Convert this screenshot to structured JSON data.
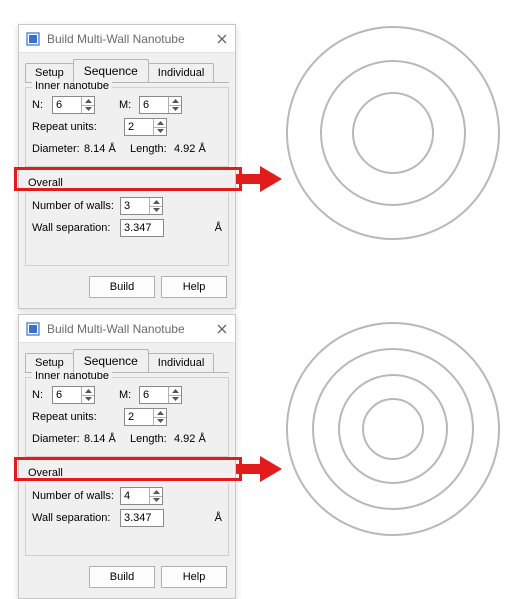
{
  "dialogs": {
    "top": {
      "title": "Build Multi-Wall Nanotube",
      "close_icon": "close",
      "tab_setup": "Setup",
      "tab_sequence": "Sequence",
      "tab_individual": "Individual",
      "inner_group": "Inner nanotube",
      "n_label": "N:",
      "n_value": "6",
      "m_label": "M:",
      "m_value": "6",
      "repeat_label": "Repeat units:",
      "repeat_value": "2",
      "diameter_label": "Diameter:",
      "diameter_value": "8.14 Å",
      "length_label": "Length:",
      "length_value": "4.92 Å",
      "overall_group": "Overall",
      "num_walls_label": "Number of walls:",
      "num_walls_value": "3",
      "sep_label": "Wall separation:",
      "sep_value": "3.347",
      "sep_unit": "Å",
      "btn_build": "Build",
      "btn_help": "Help"
    },
    "bottom": {
      "title": "Build Multi-Wall Nanotube",
      "close_icon": "close",
      "tab_setup": "Setup",
      "tab_sequence": "Sequence",
      "tab_individual": "Individual",
      "inner_group": "Inner nanotube",
      "n_label": "N:",
      "n_value": "6",
      "m_label": "M:",
      "m_value": "6",
      "repeat_label": "Repeat units:",
      "repeat_value": "2",
      "diameter_label": "Diameter:",
      "diameter_value": "8.14 Å",
      "length_label": "Length:",
      "length_value": "4.92 Å",
      "overall_group": "Overall",
      "num_walls_label": "Number of walls:",
      "num_walls_value": "4",
      "sep_label": "Wall separation:",
      "sep_value": "3.347",
      "sep_unit": "Å",
      "btn_build": "Build",
      "btn_help": "Help"
    }
  },
  "visual": {
    "top_rings": 3,
    "bottom_rings": 4
  }
}
